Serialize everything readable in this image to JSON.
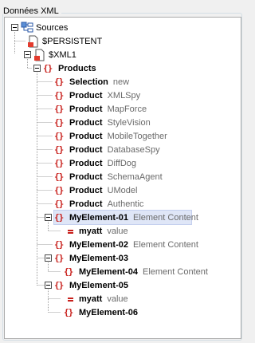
{
  "panel": {
    "title": "Données XML"
  },
  "tree": {
    "root": "Sources",
    "persistent": "$PERSISTENT",
    "xml1": "$XML1",
    "products": "Products",
    "rows": [
      {
        "label": "Selection",
        "value": "new"
      },
      {
        "label": "Product",
        "value": "XMLSpy"
      },
      {
        "label": "Product",
        "value": "MapForce"
      },
      {
        "label": "Product",
        "value": "StyleVision"
      },
      {
        "label": "Product",
        "value": "MobileTogether"
      },
      {
        "label": "Product",
        "value": "DatabaseSpy"
      },
      {
        "label": "Product",
        "value": "DiffDog"
      },
      {
        "label": "Product",
        "value": "SchemaAgent"
      },
      {
        "label": "Product",
        "value": "UModel"
      },
      {
        "label": "Product",
        "value": "Authentic"
      }
    ],
    "el1": {
      "label": "MyElement-01",
      "value": "Element Content"
    },
    "el1_attr": {
      "label": "myatt",
      "value": "value"
    },
    "el2": {
      "label": "MyElement-02",
      "value": "Element Content"
    },
    "el3": {
      "label": "MyElement-03"
    },
    "el4": {
      "label": "MyElement-04",
      "value": "Element Content"
    },
    "el5": {
      "label": "MyElement-05"
    },
    "el5_attr": {
      "label": "myatt",
      "value": "value"
    },
    "el6": {
      "label": "MyElement-06"
    }
  },
  "colors": {
    "element_icon": "#c8201c",
    "selection_bg": "#dfe6f7",
    "value_text": "#6a6a6a"
  }
}
